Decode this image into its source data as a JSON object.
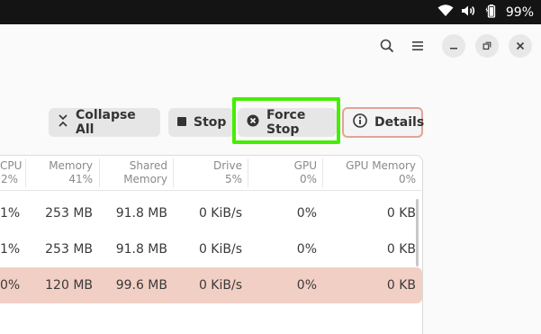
{
  "system": {
    "battery_pct": "99%"
  },
  "toolbar": {
    "collapse_label": "Collapse All",
    "stop_label": "Stop",
    "force_stop_label": "Force Stop",
    "details_label": "Details"
  },
  "table": {
    "headers": [
      {
        "name": "CPU",
        "sub": "2%"
      },
      {
        "name": "Memory",
        "sub": "41%"
      },
      {
        "name": "Shared",
        "sub": "Memory"
      },
      {
        "name": "Drive",
        "sub": "5%"
      },
      {
        "name": "GPU",
        "sub": "0%"
      },
      {
        "name": "GPU Memory",
        "sub": "0%"
      }
    ],
    "rows": [
      {
        "cpu": "1%",
        "mem": "253 MB",
        "shared": "91.8 MB",
        "drive": "0 KiB/s",
        "gpu": "0%",
        "gpumem": "0 KB"
      },
      {
        "cpu": "1%",
        "mem": "253 MB",
        "shared": "91.8 MB",
        "drive": "0 KiB/s",
        "gpu": "0%",
        "gpumem": "0 KB"
      },
      {
        "cpu": "0%",
        "mem": "120 MB",
        "shared": "99.6 MB",
        "drive": "0 KiB/s",
        "gpu": "0%",
        "gpumem": "0 KB"
      }
    ]
  },
  "colors": {
    "highlight": "#44ee00",
    "selected_row": "#f2cfc4",
    "details_border": "#e0a597"
  }
}
